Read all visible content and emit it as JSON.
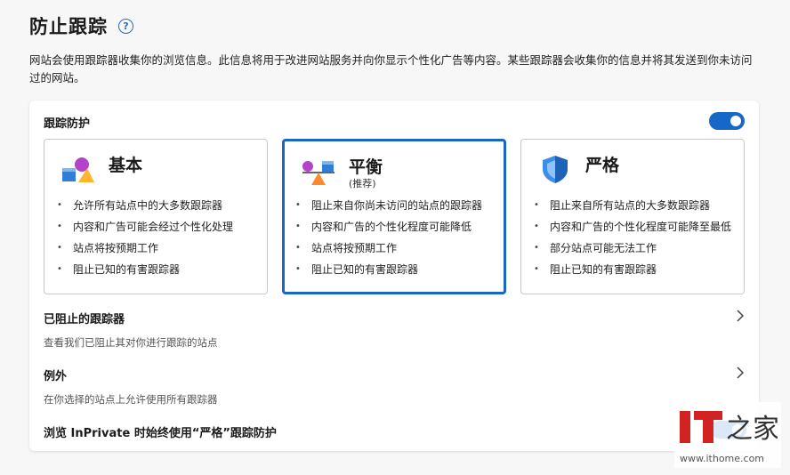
{
  "header": {
    "title": "防止跟踪",
    "help_glyph": "?",
    "description": "网站会使用跟踪器收集你的浏览信息。此信息将用于改进网站服务并向你显示个性化广告等内容。某些跟踪器会收集你的信息并将其发送到你未访问过的网站。"
  },
  "tracking": {
    "label": "跟踪防护",
    "enabled": true,
    "accent": "#1767c7"
  },
  "cards": [
    {
      "name": "基本",
      "sub": "",
      "icon": "shapes-icon",
      "bullets": [
        "允许所有站点中的大多数跟踪器",
        "内容和广告可能会经过个性化处理",
        "站点将按预期工作",
        "阻止已知的有害跟踪器"
      ]
    },
    {
      "name": "平衡",
      "sub": "(推荐)",
      "icon": "balance-icon",
      "bullets": [
        "阻止来自你尚未访问的站点的跟踪器",
        "内容和广告的个性化程度可能降低",
        "站点将按预期工作",
        "阻止已知的有害跟踪器"
      ]
    },
    {
      "name": "严格",
      "sub": "",
      "icon": "shield-icon",
      "bullets": [
        "阻止来自所有站点的大多数跟踪器",
        "内容和广告的个性化程度可能降至最低",
        "部分站点可能无法工作",
        "阻止已知的有害跟踪器"
      ]
    }
  ],
  "selected_card": 1,
  "bullet_glyph": "•",
  "rows": {
    "blocked": {
      "title": "已阻止的跟踪器",
      "sub": "查看我们已阻止其对你进行跟踪的站点"
    },
    "exceptions": {
      "title": "例外",
      "sub": "在你选择的站点上允许使用所有跟踪器"
    },
    "inprivate": {
      "title": "浏览 InPrivate 时始终使用“严格”跟踪防护"
    }
  },
  "watermark": {
    "logo_text": "IT之家",
    "url": "www.ithome.com",
    "brand_color": "#d22222"
  }
}
